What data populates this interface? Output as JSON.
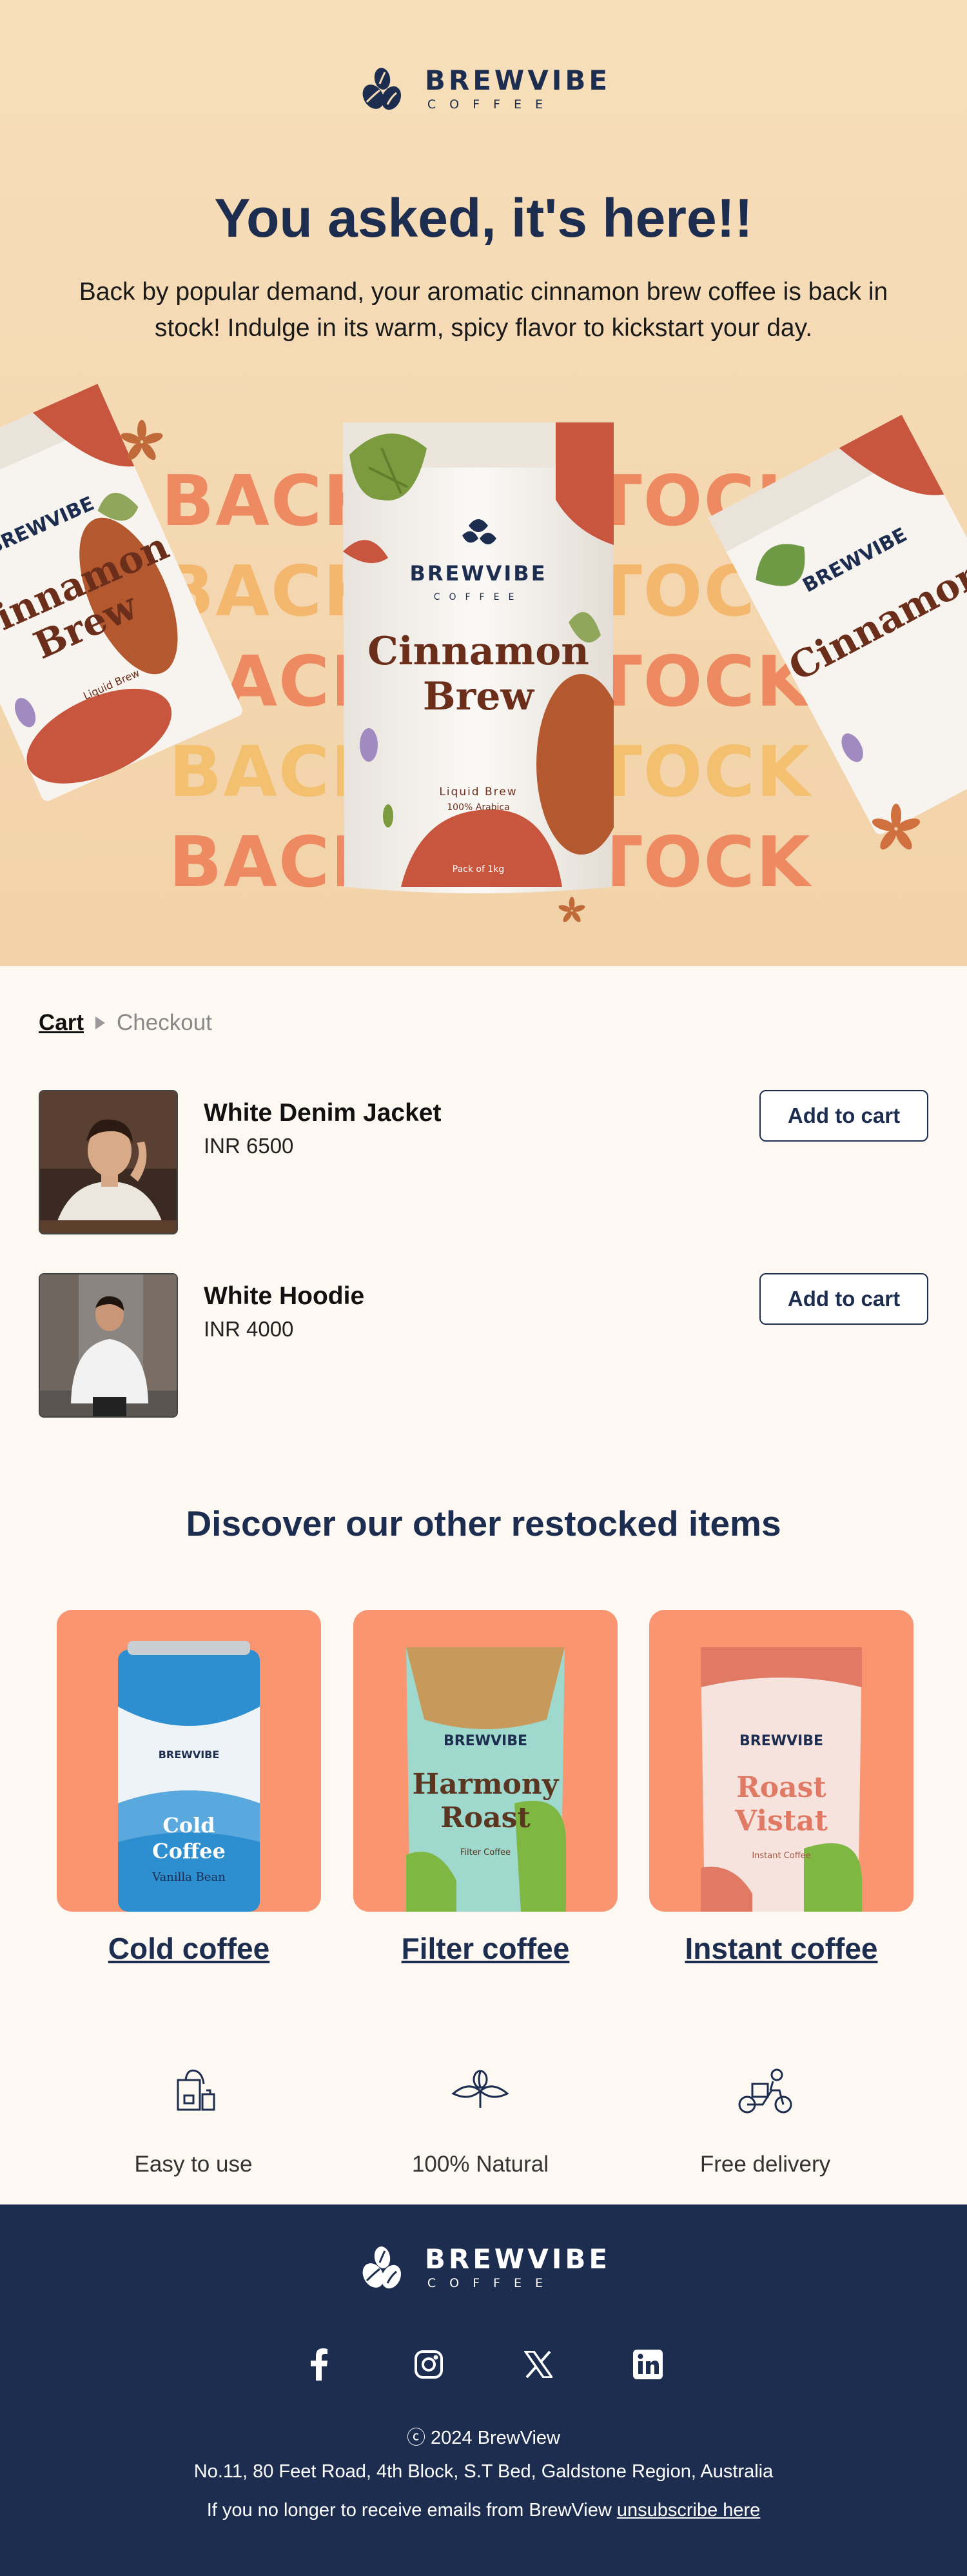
{
  "brand": {
    "name": "BREWVIBE",
    "sub": "COFFEE"
  },
  "hero": {
    "title": "You asked, it's here!!",
    "text": "Back by popular demand, your aromatic cinnamon brew coffee is back in stock! Indulge in its warm, spicy flavor to kickstart your day.",
    "background_word_left": "BACK",
    "background_word_right": "TOCK",
    "pouch": {
      "brand": "BREWVIBE",
      "brand_sub": "COFFEE",
      "title_line1": "Cinnamon",
      "title_line2": "Brew",
      "sub1": "Liquid Brew",
      "sub2": "100% Arabica",
      "pack": "Pack of 1kg"
    },
    "colors": {
      "background": "#f5dab4",
      "accent": "#e9795a",
      "navy": "#1c2d4f"
    }
  },
  "breadcrumb": {
    "cart": "Cart",
    "checkout": "Checkout"
  },
  "cart_items": [
    {
      "name": "White Denim Jacket",
      "price": "INR 6500",
      "button": "Add to cart"
    },
    {
      "name": "White Hoodie",
      "price": "INR 4000",
      "button": "Add to cart"
    }
  ],
  "discover": {
    "title": "Discover our other restocked items",
    "products": [
      {
        "label": "Cold coffee",
        "pack_title1": "Cold",
        "pack_title2": "Coffee",
        "pack_sub": "Vanilla Bean"
      },
      {
        "label": "Filter coffee",
        "pack_title1": "Harmony",
        "pack_title2": "Roast",
        "pack_sub": "Filter Coffee"
      },
      {
        "label": "Instant coffee",
        "pack_title1": "Roast",
        "pack_title2": "Vistat",
        "pack_sub": "Instant Coffee"
      }
    ]
  },
  "features": [
    {
      "label": "Easy to use",
      "icon": "teabag-cup-icon"
    },
    {
      "label": "100% Natural",
      "icon": "coffee-leaf-icon"
    },
    {
      "label": "Free delivery",
      "icon": "scooter-delivery-icon"
    }
  ],
  "footer": {
    "copyright": "ⓒ 2024 BrewView",
    "address": "No.11, 80 Feet Road, 4th Block, S.T Bed, Galdstone Region,  Australia",
    "unsub_text": "If you no longer to receive emails from BrewView ",
    "unsub_link": "unsubscribe here",
    "socials": [
      "facebook-icon",
      "instagram-icon",
      "x-icon",
      "linkedin-icon"
    ]
  }
}
